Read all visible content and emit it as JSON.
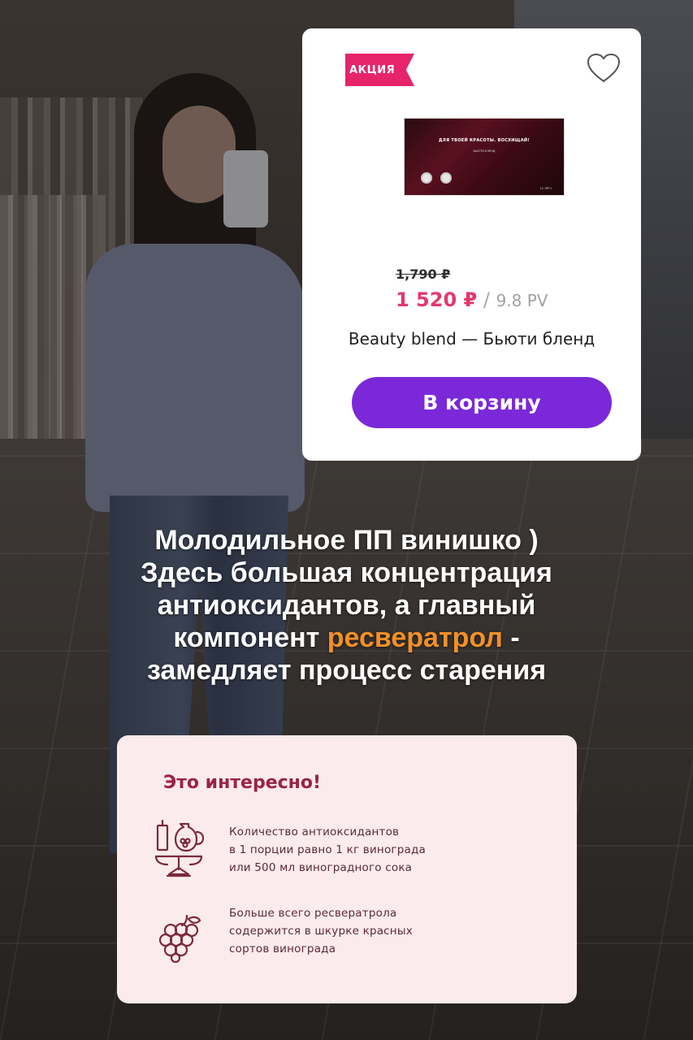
{
  "product": {
    "badge": "АКЦИЯ",
    "image_tagline": "ДЛЯ ТВОЕЙ КРАСОТЫ. ВОСХИЩАЙ!",
    "image_subtitle": "БЬЮТИ БЛЕНД",
    "image_age": "12 ЛЕТ+",
    "old_price": "1,790 ₽",
    "current_price": "1 520 ₽",
    "pv_separator": " / ",
    "pv": "9.8 PV",
    "name": "Beauty blend — Бьюти бленд",
    "cart_button_label": "В корзину"
  },
  "caption": {
    "line1": "Молодильное ПП винишко )",
    "line2": "Здесь большая концентрация",
    "line3": "антиоксидантов, а главный",
    "line4_prefix": "компонент ",
    "line4_highlight": "ресвератрол",
    "line4_suffix": " -",
    "line5": "замедляет процесс старения"
  },
  "info": {
    "title": "Это интересно!",
    "fact1": [
      "Количество антиоксидантов",
      "в 1 порции равно 1 кг винограда",
      "или 500 мл виноградного сока"
    ],
    "fact2": [
      "Больше всего ресвератрола",
      "содержится в шкурке красных",
      "сортов винограда"
    ]
  },
  "colors": {
    "accent_purple": "#7b28d9",
    "sale_pink": "#e6246a",
    "price_pink": "#e0396e",
    "highlight_orange": "#f29029",
    "info_title": "#9a2246"
  },
  "icons": [
    "heart-icon",
    "scale-icon",
    "grapes-icon"
  ]
}
